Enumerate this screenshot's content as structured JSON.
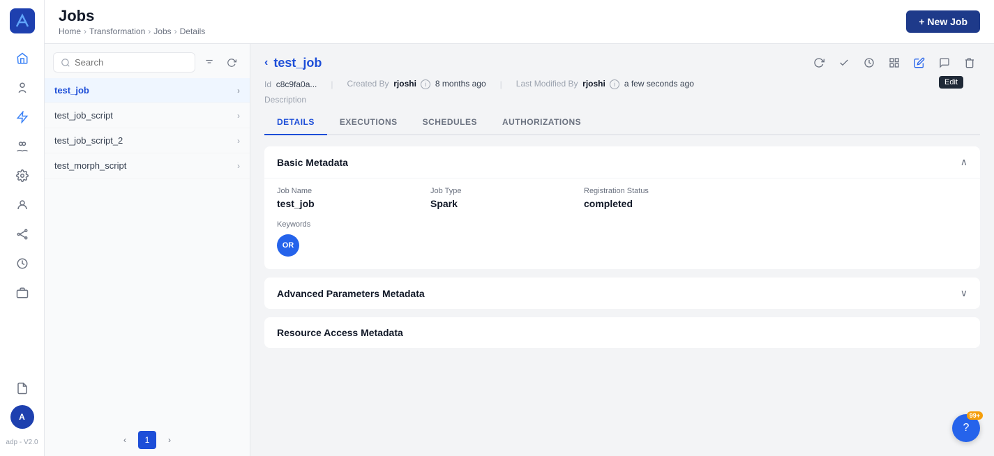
{
  "app": {
    "logo_initials": "A",
    "version": "adp - V2.0"
  },
  "header": {
    "title": "Jobs",
    "new_job_label": "+ New Job",
    "breadcrumb": [
      "Home",
      "Transformation",
      "Jobs",
      "Details"
    ]
  },
  "sidebar": {
    "search_placeholder": "Search",
    "items": [
      {
        "name": "test_job",
        "active": true
      },
      {
        "name": "test_job_script",
        "active": false
      },
      {
        "name": "test_job_script_2",
        "active": false
      },
      {
        "name": "test_morph_script",
        "active": false
      }
    ],
    "page_current": 1
  },
  "detail": {
    "job_name_title": "test_job",
    "id_label": "Id",
    "id_value": "c8c9fa0a...",
    "created_by_label": "Created By",
    "created_by_user": "rjoshi",
    "created_by_time": "8 months ago",
    "modified_by_label": "Last Modified By",
    "modified_by_user": "rjoshi",
    "modified_by_time": "a few seconds ago",
    "description_label": "Description",
    "tabs": [
      "DETAILS",
      "EXECUTIONS",
      "SCHEDULES",
      "AUTHORIZATIONS"
    ],
    "active_tab": "DETAILS",
    "edit_tooltip": "Edit",
    "basic_metadata": {
      "title": "Basic Metadata",
      "job_name_label": "Job Name",
      "job_name_value": "test_job",
      "job_type_label": "Job Type",
      "job_type_value": "Spark",
      "registration_status_label": "Registration Status",
      "registration_status_value": "completed",
      "keywords_label": "Keywords",
      "keyword_badge": "OR"
    },
    "advanced_parameters": {
      "title": "Advanced Parameters Metadata"
    },
    "resource_access": {
      "title": "Resource Access Metadata"
    }
  },
  "help": {
    "badge": "99+",
    "icon": "?"
  },
  "nav_icons": [
    {
      "name": "home-icon",
      "symbol": "⌂"
    },
    {
      "name": "people-icon",
      "symbol": "👤"
    },
    {
      "name": "transform-icon",
      "symbol": "⚡"
    },
    {
      "name": "group-icon",
      "symbol": "👥"
    },
    {
      "name": "settings-icon",
      "symbol": "⚙"
    },
    {
      "name": "user-icon",
      "symbol": "🧍"
    },
    {
      "name": "connections-icon",
      "symbol": "⎇"
    },
    {
      "name": "history-icon",
      "symbol": "🕐"
    },
    {
      "name": "bag-icon",
      "symbol": "💼"
    },
    {
      "name": "doc-icon",
      "symbol": "📄"
    }
  ]
}
